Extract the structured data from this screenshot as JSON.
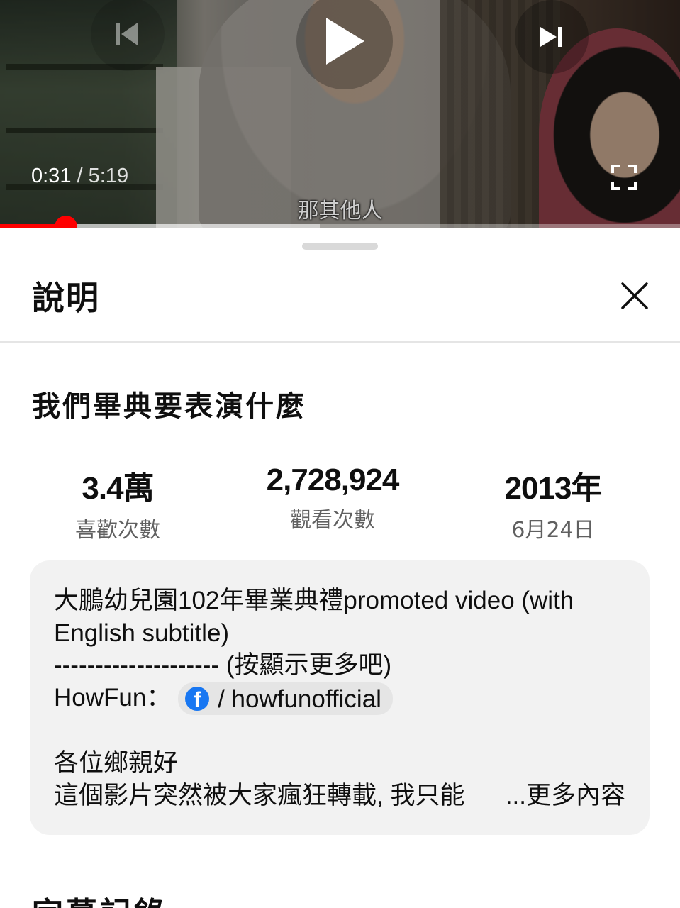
{
  "player": {
    "current_time": "0:31",
    "separator": " / ",
    "duration": "5:19",
    "subtitle": "那其他人",
    "progress_fraction": 0.097,
    "buffered_fraction": 0.47,
    "accent_color": "#ff0000",
    "icons": {
      "previous": "previous-icon",
      "play": "play-icon",
      "next": "next-icon",
      "fullscreen": "fullscreen-icon"
    }
  },
  "sheet": {
    "title": "說明",
    "close_icon": "close-icon"
  },
  "video": {
    "title": "我們畢典要表演什麼"
  },
  "stats": {
    "likes": {
      "value": "3.4萬",
      "label": "喜歡次數"
    },
    "views": {
      "value": "2,728,924",
      "label": "觀看次數"
    },
    "date": {
      "value": "2013年",
      "label": "6月24日"
    }
  },
  "description": {
    "line1": "大鵬幼兒園102年畢業典禮promoted video (with",
    "line2": "English subtitle)",
    "line3": "-------------------- (按顯示更多吧)",
    "line4_prefix": "HowFun：",
    "link_text": "/ howfunofficial",
    "link_icon": "facebook-icon",
    "line5": "各位鄉親好",
    "line6": "這個影片突然被大家瘋狂轉載, 我只能",
    "more_label": "...更多內容"
  },
  "next_section": {
    "title": "字幕記錄"
  }
}
